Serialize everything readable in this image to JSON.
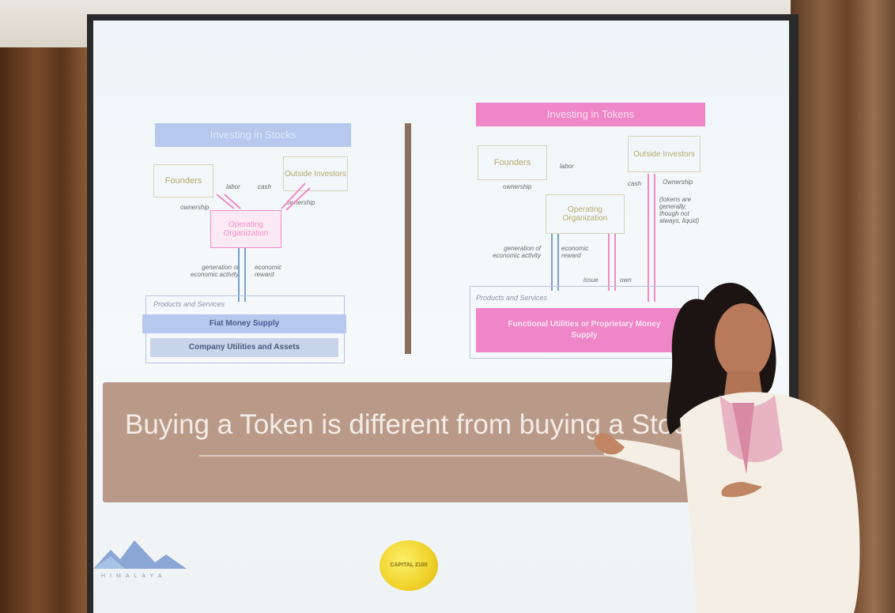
{
  "slide": {
    "left_title": "Investing in Stocks",
    "left_founders": "Founders",
    "left_investors": "Outside Investors",
    "left_operating": "Operating Organization",
    "left_labor": "labor",
    "left_cash": "cash",
    "left_ownership_a": "ownership",
    "left_ownership_b": "ownership",
    "left_generation": "generation of economic activity",
    "left_reward": "economic reward",
    "left_products": "Products and Services",
    "left_fiat": "Fiat Money Supply",
    "left_company": "Company Utilities and Assets",
    "right_title": "Investing in Tokens",
    "right_founders": "Founders",
    "right_investors": "Outside Investors",
    "right_operating": "Operating Organization",
    "right_labor": "labor",
    "right_cash": "cash",
    "right_ownership": "ownership",
    "right_ownership_cap": "Ownership",
    "right_tokens_note": "(tokens are generally, though not always, liquid)",
    "right_generation": "generation of economic activity",
    "right_reward": "economic reward",
    "right_issue": "issue",
    "right_own": "own",
    "right_products": "Products and Services",
    "right_functional": "Functional Utilities or Proprietary Money Supply",
    "headline": "Buying a Token is different from buying a Stock",
    "logo_text": "HIMALAYA",
    "coin_text": "CAPITAL 2100"
  },
  "colors": {
    "stocks_blue": "#b6c8ee",
    "tokens_pink": "#ee86c8",
    "band_brown": "#b99a88"
  }
}
